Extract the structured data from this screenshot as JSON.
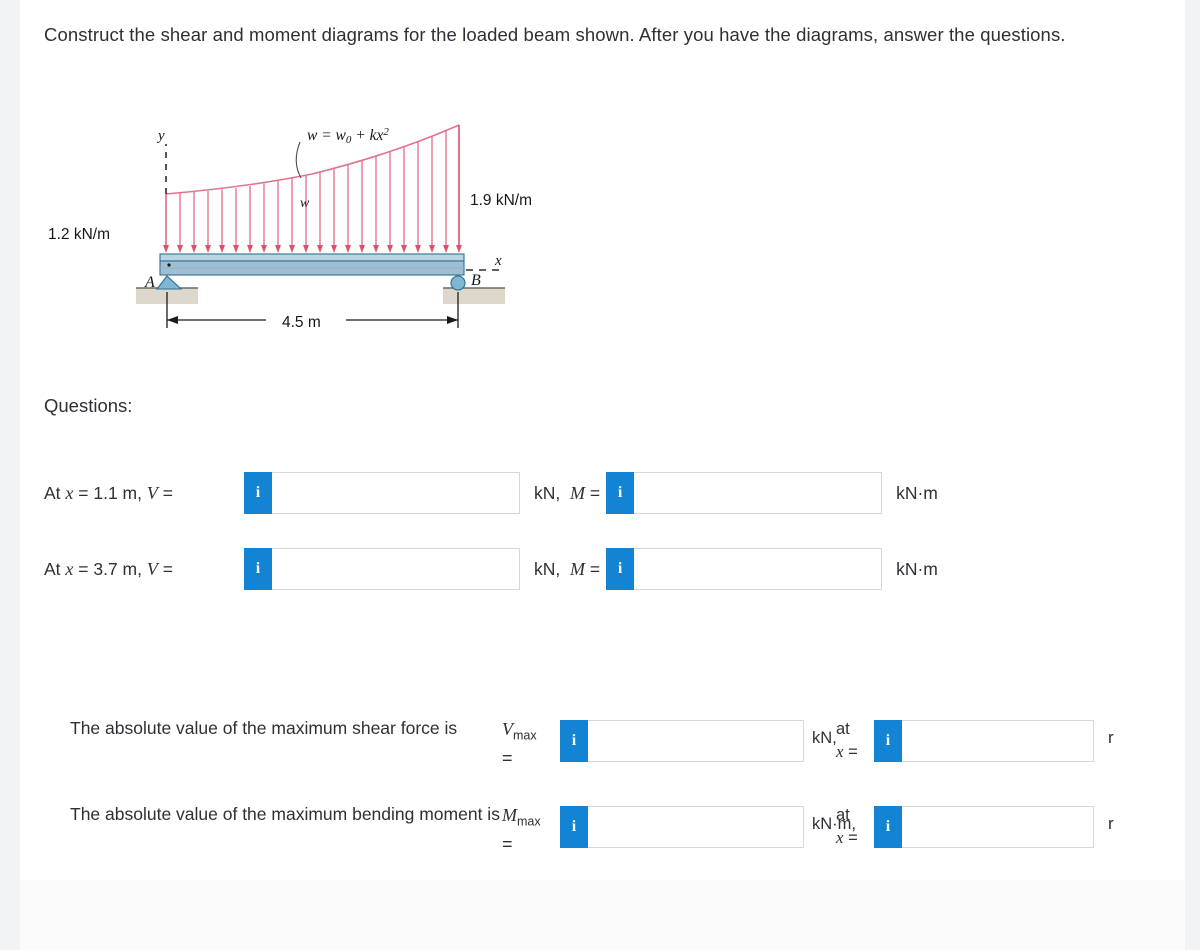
{
  "prompt": "Construct the shear and moment diagrams for the loaded beam shown. After you have the diagrams, answer the questions.",
  "questions_heading": "Questions:",
  "figure": {
    "y_axis_label": "y",
    "x_axis_label": "x",
    "load_equation": "w = w₀ + kx²",
    "load_symbol": "w",
    "left_intensity": "1.2 kN/m",
    "right_intensity": "1.9 kN/m",
    "support_a_label": "A",
    "support_b_label": "B",
    "span_label": "4.5 m",
    "colors": {
      "load_arrows": "#d9536f",
      "load_curve": "#e0728d",
      "beam_fill": "#a8c4d8",
      "beam_edge": "#2f6f94",
      "support_fill": "#7eb7d4",
      "ground_fill": "#ded8cc"
    }
  },
  "rows": [
    {
      "label_prefix": "At ",
      "label_x": "x",
      "label_mid": " = 1.1 m,   ",
      "label_v": "V",
      "label_eq": " =",
      "info_icon": "info-icon",
      "v_value": "",
      "v_unit": "kN,",
      "m_symbol": "M",
      "m_eq": " =",
      "m_value": "",
      "m_unit": "kN·m"
    },
    {
      "label_prefix": "At ",
      "label_x": "x",
      "label_mid": " = 3.7 m,   ",
      "label_v": "V",
      "label_eq": " =",
      "info_icon": "info-icon",
      "v_value": "",
      "v_unit": "kN,",
      "m_symbol": "M",
      "m_eq": " =",
      "m_value": "",
      "m_unit": "kN·m"
    }
  ],
  "lower_rows": [
    {
      "text": "The absolute value of the maximum shear force is",
      "symbol": "V",
      "symbol_sub": "max",
      "symbol_eq": "=",
      "value": "",
      "unit": "kN,",
      "at_label": "at",
      "x_label": "x",
      "x_eq": " =",
      "at_value": "",
      "trailing": "r"
    },
    {
      "text": "The absolute value of the maximum bending moment is",
      "symbol": "M",
      "symbol_sub": "max",
      "symbol_eq": "=",
      "value": "",
      "unit": "kN·m,",
      "at_label": "at",
      "x_label": "x",
      "x_eq": " =",
      "at_value": "",
      "trailing": "r"
    }
  ],
  "theme": {
    "accent_blue": "#1383d4",
    "text_color": "#2d3035",
    "input_border": "#d6d8da",
    "page_bg": "#ffffff",
    "outer_bg": "#f2f3f5"
  }
}
